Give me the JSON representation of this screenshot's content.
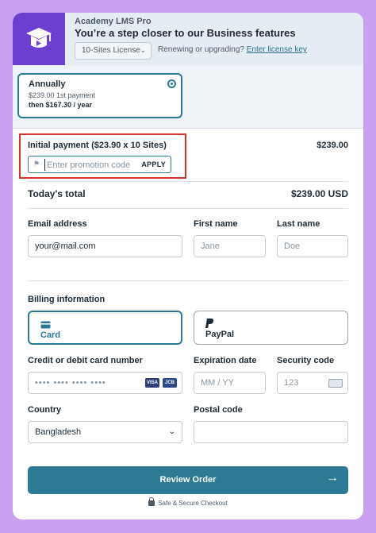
{
  "header": {
    "product_name": "Academy LMS Pro",
    "headline": "You’re a step closer to our Business features",
    "license_select": {
      "value": "10-Sites License",
      "icon": "chevron-down-icon"
    },
    "renew_text": "Renewing or upgrading?",
    "license_link": "Enter license key"
  },
  "plan": {
    "title": "Annually",
    "first_payment": "$239.00 1st payment",
    "then": "then $167.30 / year",
    "selected": true
  },
  "payment": {
    "initial_label": "Initial payment ($23.90 x 10 Sites)",
    "initial_amount": "$239.00",
    "promo_placeholder": "Enter promotion code",
    "apply_label": "APPLY",
    "total_label": "Today's total",
    "total_amount": "$239.00 USD"
  },
  "contact": {
    "email_label": "Email address",
    "email_value": "your@mail.com",
    "first_name_label": "First name",
    "first_name_placeholder": "Jane",
    "last_name_label": "Last name",
    "last_name_placeholder": "Doe"
  },
  "billing": {
    "label": "Billing information",
    "methods": [
      {
        "label": "Card",
        "icon": "credit-card-icon",
        "selected": true
      },
      {
        "label": "PayPal",
        "icon": "paypal-icon",
        "selected": false
      }
    ],
    "card_number_label": "Credit or debit card number",
    "card_number_placeholder": "•••• •••• •••• ••••",
    "card_brands": [
      "VISA",
      "JCB"
    ],
    "expiration_label": "Expiration date",
    "expiration_placeholder": "MM / YY",
    "security_label": "Security code",
    "security_placeholder": "123",
    "country_label": "Country",
    "country_value": "Bangladesh",
    "postal_label": "Postal code",
    "postal_value": ""
  },
  "actions": {
    "review_label": "Review Order",
    "review_icon": "arrow-right-icon",
    "secure_text": "Safe & Secure Checkout"
  },
  "colors": {
    "background": "#c9a0f2",
    "logo": "#6d3fd1",
    "accent": "#2c7a94",
    "highlight": "#d93030"
  }
}
